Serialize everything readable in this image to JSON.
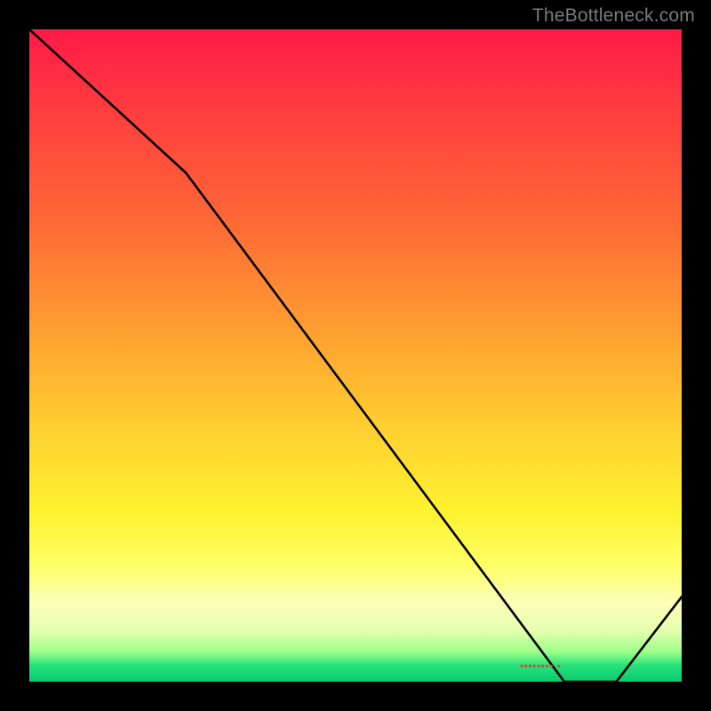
{
  "attribution": "TheBottleneck.com",
  "annotation_text": "▪▪▪▪▪▪▪▪ ▪",
  "chart_data": {
    "type": "line",
    "title": "",
    "xlabel": "",
    "ylabel": "",
    "xlim": [
      0,
      100
    ],
    "ylim": [
      0,
      100
    ],
    "series": [
      {
        "name": "bottleneck-curve",
        "x": [
          0,
          24,
          82,
          90,
          100
        ],
        "y": [
          100,
          78,
          0,
          0,
          13
        ]
      }
    ],
    "background": {
      "type": "vertical-gradient",
      "stops": [
        {
          "pos": 0,
          "color": "#ff1a47"
        },
        {
          "pos": 12,
          "color": "#ff3b3f"
        },
        {
          "pos": 30,
          "color": "#ff6a35"
        },
        {
          "pos": 48,
          "color": "#ffa531"
        },
        {
          "pos": 62,
          "color": "#ffd231"
        },
        {
          "pos": 74,
          "color": "#fff22f"
        },
        {
          "pos": 82,
          "color": "#feff65"
        },
        {
          "pos": 88,
          "color": "#fcffb8"
        },
        {
          "pos": 92,
          "color": "#e8ffb0"
        },
        {
          "pos": 95.5,
          "color": "#9bff88"
        },
        {
          "pos": 97.5,
          "color": "#24e27a"
        },
        {
          "pos": 100,
          "color": "#0cca70"
        }
      ]
    },
    "annotations": [
      {
        "name": "optimal-marker",
        "x": 82,
        "y": 2
      }
    ]
  }
}
